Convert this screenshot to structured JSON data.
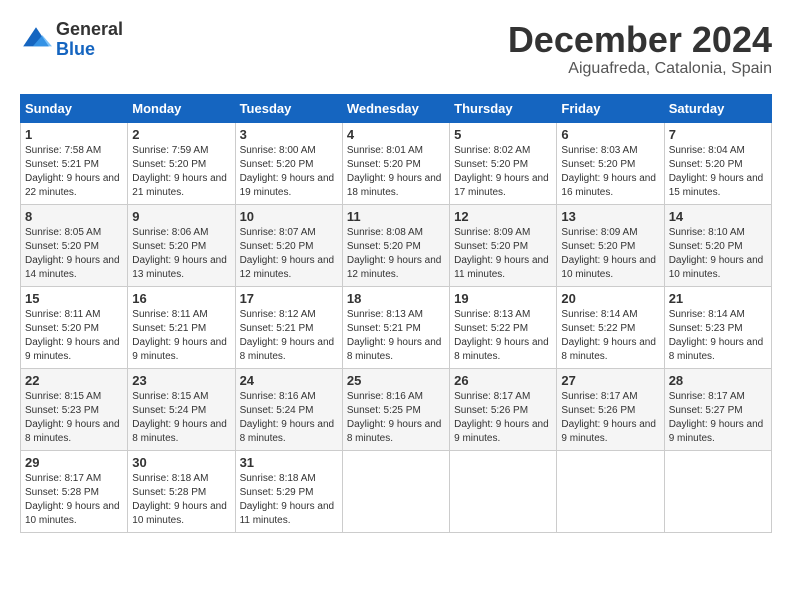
{
  "logo": {
    "general": "General",
    "blue": "Blue"
  },
  "title": "December 2024",
  "subtitle": "Aiguafreda, Catalonia, Spain",
  "weekdays": [
    "Sunday",
    "Monday",
    "Tuesday",
    "Wednesday",
    "Thursday",
    "Friday",
    "Saturday"
  ],
  "weeks": [
    [
      {
        "day": "1",
        "sunrise": "7:58 AM",
        "sunset": "5:21 PM",
        "daylight": "9 hours and 22 minutes."
      },
      {
        "day": "2",
        "sunrise": "7:59 AM",
        "sunset": "5:20 PM",
        "daylight": "9 hours and 21 minutes."
      },
      {
        "day": "3",
        "sunrise": "8:00 AM",
        "sunset": "5:20 PM",
        "daylight": "9 hours and 19 minutes."
      },
      {
        "day": "4",
        "sunrise": "8:01 AM",
        "sunset": "5:20 PM",
        "daylight": "9 hours and 18 minutes."
      },
      {
        "day": "5",
        "sunrise": "8:02 AM",
        "sunset": "5:20 PM",
        "daylight": "9 hours and 17 minutes."
      },
      {
        "day": "6",
        "sunrise": "8:03 AM",
        "sunset": "5:20 PM",
        "daylight": "9 hours and 16 minutes."
      },
      {
        "day": "7",
        "sunrise": "8:04 AM",
        "sunset": "5:20 PM",
        "daylight": "9 hours and 15 minutes."
      }
    ],
    [
      {
        "day": "8",
        "sunrise": "8:05 AM",
        "sunset": "5:20 PM",
        "daylight": "9 hours and 14 minutes."
      },
      {
        "day": "9",
        "sunrise": "8:06 AM",
        "sunset": "5:20 PM",
        "daylight": "9 hours and 13 minutes."
      },
      {
        "day": "10",
        "sunrise": "8:07 AM",
        "sunset": "5:20 PM",
        "daylight": "9 hours and 12 minutes."
      },
      {
        "day": "11",
        "sunrise": "8:08 AM",
        "sunset": "5:20 PM",
        "daylight": "9 hours and 12 minutes."
      },
      {
        "day": "12",
        "sunrise": "8:09 AM",
        "sunset": "5:20 PM",
        "daylight": "9 hours and 11 minutes."
      },
      {
        "day": "13",
        "sunrise": "8:09 AM",
        "sunset": "5:20 PM",
        "daylight": "9 hours and 10 minutes."
      },
      {
        "day": "14",
        "sunrise": "8:10 AM",
        "sunset": "5:20 PM",
        "daylight": "9 hours and 10 minutes."
      }
    ],
    [
      {
        "day": "15",
        "sunrise": "8:11 AM",
        "sunset": "5:20 PM",
        "daylight": "9 hours and 9 minutes."
      },
      {
        "day": "16",
        "sunrise": "8:11 AM",
        "sunset": "5:21 PM",
        "daylight": "9 hours and 9 minutes."
      },
      {
        "day": "17",
        "sunrise": "8:12 AM",
        "sunset": "5:21 PM",
        "daylight": "9 hours and 8 minutes."
      },
      {
        "day": "18",
        "sunrise": "8:13 AM",
        "sunset": "5:21 PM",
        "daylight": "9 hours and 8 minutes."
      },
      {
        "day": "19",
        "sunrise": "8:13 AM",
        "sunset": "5:22 PM",
        "daylight": "9 hours and 8 minutes."
      },
      {
        "day": "20",
        "sunrise": "8:14 AM",
        "sunset": "5:22 PM",
        "daylight": "9 hours and 8 minutes."
      },
      {
        "day": "21",
        "sunrise": "8:14 AM",
        "sunset": "5:23 PM",
        "daylight": "9 hours and 8 minutes."
      }
    ],
    [
      {
        "day": "22",
        "sunrise": "8:15 AM",
        "sunset": "5:23 PM",
        "daylight": "9 hours and 8 minutes."
      },
      {
        "day": "23",
        "sunrise": "8:15 AM",
        "sunset": "5:24 PM",
        "daylight": "9 hours and 8 minutes."
      },
      {
        "day": "24",
        "sunrise": "8:16 AM",
        "sunset": "5:24 PM",
        "daylight": "9 hours and 8 minutes."
      },
      {
        "day": "25",
        "sunrise": "8:16 AM",
        "sunset": "5:25 PM",
        "daylight": "9 hours and 8 minutes."
      },
      {
        "day": "26",
        "sunrise": "8:17 AM",
        "sunset": "5:26 PM",
        "daylight": "9 hours and 9 minutes."
      },
      {
        "day": "27",
        "sunrise": "8:17 AM",
        "sunset": "5:26 PM",
        "daylight": "9 hours and 9 minutes."
      },
      {
        "day": "28",
        "sunrise": "8:17 AM",
        "sunset": "5:27 PM",
        "daylight": "9 hours and 9 minutes."
      }
    ],
    [
      {
        "day": "29",
        "sunrise": "8:17 AM",
        "sunset": "5:28 PM",
        "daylight": "9 hours and 10 minutes."
      },
      {
        "day": "30",
        "sunrise": "8:18 AM",
        "sunset": "5:28 PM",
        "daylight": "9 hours and 10 minutes."
      },
      {
        "day": "31",
        "sunrise": "8:18 AM",
        "sunset": "5:29 PM",
        "daylight": "9 hours and 11 minutes."
      },
      null,
      null,
      null,
      null
    ]
  ],
  "labels": {
    "sunrise": "Sunrise:",
    "sunset": "Sunset:",
    "daylight": "Daylight:"
  }
}
